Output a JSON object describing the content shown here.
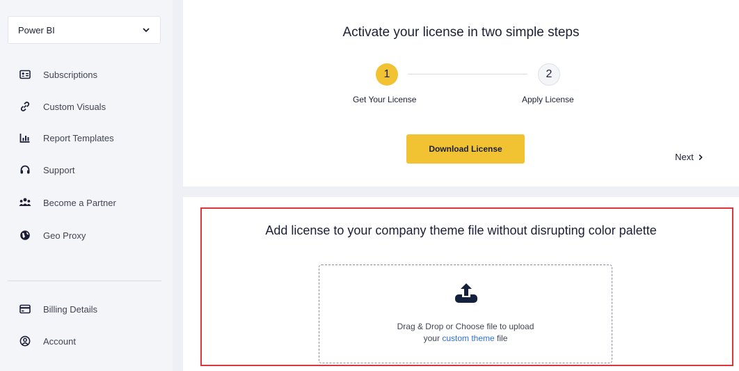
{
  "sidebar": {
    "product_select": "Power BI",
    "items": [
      {
        "label": "Subscriptions",
        "icon": "id-card-icon"
      },
      {
        "label": "Custom Visuals",
        "icon": "link-icon"
      },
      {
        "label": "Report Templates",
        "icon": "bar-chart-icon"
      },
      {
        "label": "Support",
        "icon": "headset-icon"
      },
      {
        "label": "Become a Partner",
        "icon": "users-icon"
      },
      {
        "label": "Geo Proxy",
        "icon": "globe-icon"
      }
    ],
    "bottom_items": [
      {
        "label": "Billing Details",
        "icon": "credit-card-icon"
      },
      {
        "label": "Account",
        "icon": "user-circle-icon"
      }
    ]
  },
  "activation": {
    "title": "Activate your license in two simple steps",
    "steps": [
      {
        "number": "1",
        "label": "Get Your License"
      },
      {
        "number": "2",
        "label": "Apply License"
      }
    ],
    "download_button": "Download License",
    "next_label": "Next"
  },
  "theme_upload": {
    "title": "Add license to your company theme file without disrupting color palette",
    "drop_text_line1": "Drag & Drop or Choose file to upload",
    "drop_text_prefix": "your",
    "drop_text_link": "custom theme",
    "drop_text_suffix": "file"
  },
  "colors": {
    "accent": "#f1c232",
    "highlight_border": "#d9363e",
    "link": "#2f6fd8"
  }
}
